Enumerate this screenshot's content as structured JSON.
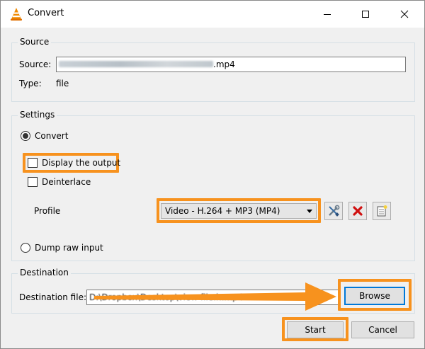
{
  "window": {
    "title": "Convert",
    "controls": {
      "minimize": "minimize",
      "maximize": "maximize",
      "close": "close"
    }
  },
  "source": {
    "group_title": "Source",
    "source_label": "Source:",
    "source_value_visible_suffix": ".mp4",
    "type_label": "Type:",
    "type_value": "file"
  },
  "settings": {
    "group_title": "Settings",
    "convert_label": "Convert",
    "convert_checked": true,
    "display_output_label": "Display the output",
    "display_output_checked": false,
    "deinterlace_label": "Deinterlace",
    "deinterlace_checked": false,
    "profile_label": "Profile",
    "profile_selected": "Video - H.264 + MP3 (MP4)",
    "dump_raw_label": "Dump raw input",
    "dump_raw_checked": false
  },
  "destination": {
    "group_title": "Destination",
    "file_label": "Destination file:",
    "file_value": "D:\\Dropbox\\Desktop\\view file.h.mp4",
    "browse_label": "Browse"
  },
  "actions": {
    "start_label": "Start",
    "cancel_label": "Cancel"
  },
  "colors": {
    "highlight": "#f7921e",
    "focus_blue": "#0078d7",
    "vlc_orange": "#f08a00"
  },
  "icons": [
    "vlc-cone-icon",
    "wrench-screwdriver-icon",
    "delete-x-icon",
    "new-profile-icon",
    "chevron-down-icon"
  ]
}
